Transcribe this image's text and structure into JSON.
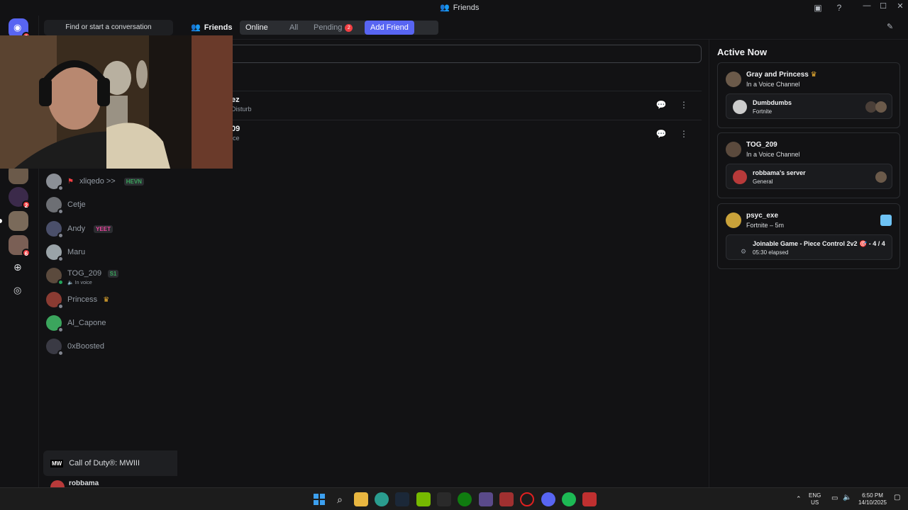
{
  "window": {
    "title": "Friends"
  },
  "rail": {
    "home_badge": "3",
    "server_badges": [
      "2",
      "6"
    ]
  },
  "sidebar": {
    "search_label": "Find or start a conversation",
    "dms": [
      {
        "name": "xliqedo >>",
        "tag": "HEVN",
        "sub": "",
        "color": "#8b8f96"
      },
      {
        "name": "Cetje",
        "tag": "",
        "sub": "",
        "color": "#6d6f74"
      },
      {
        "name": "Andy",
        "tag": "YEET",
        "sub": "",
        "color": "#4a4f6a"
      },
      {
        "name": "Maru",
        "tag": "",
        "sub": "",
        "color": "#9aa3a8"
      },
      {
        "name": "TOG_209",
        "tag": "S1",
        "sub": "In voice",
        "color": "#5b4a3d"
      },
      {
        "name": "Princess",
        "tag": "",
        "sub": "",
        "color": "#8a3b32"
      },
      {
        "name": "Al_Capone",
        "tag": "",
        "sub": "",
        "color": "#3ba55d"
      },
      {
        "name": "0xBoosted",
        "tag": "",
        "sub": "",
        "color": "#3a3a44"
      }
    ],
    "game_bar": {
      "name": "Call of Duty®: MWIII"
    },
    "user": {
      "name": "robbama"
    }
  },
  "topnav": {
    "friends_label": "Friends",
    "tabs": [
      "Online",
      "All",
      "Pending"
    ],
    "pending_count": "2",
    "add_friend": "Add Friend"
  },
  "main": {
    "rows": [
      {
        "name": "ez",
        "status": "Disturb"
      },
      {
        "name": "09",
        "status": "ice"
      }
    ]
  },
  "active_now": {
    "heading": "Active Now",
    "cards": [
      {
        "title": "Gray and Princess",
        "sub": "In a Voice Channel",
        "inner_title": "Dumbdumbs",
        "inner_sub": "Fortnite"
      },
      {
        "title": "TOG_209",
        "sub": "In a Voice Channel",
        "inner_title": "robbama's server",
        "inner_sub": "General"
      },
      {
        "title": "psyc_exe",
        "sub": "Fortnite – 5m",
        "inner_title": "Joinable Game - Piece Control 2v2 🎯 - 4 / 4",
        "inner_sub": "05:30 elapsed"
      }
    ]
  },
  "taskbar": {
    "lang": "ENG",
    "region": "US",
    "time": "6:50 PM",
    "date": "14/10/2025"
  },
  "colors": {
    "accent": "#5865f2",
    "danger": "#f23f43",
    "online": "#23a55a"
  }
}
